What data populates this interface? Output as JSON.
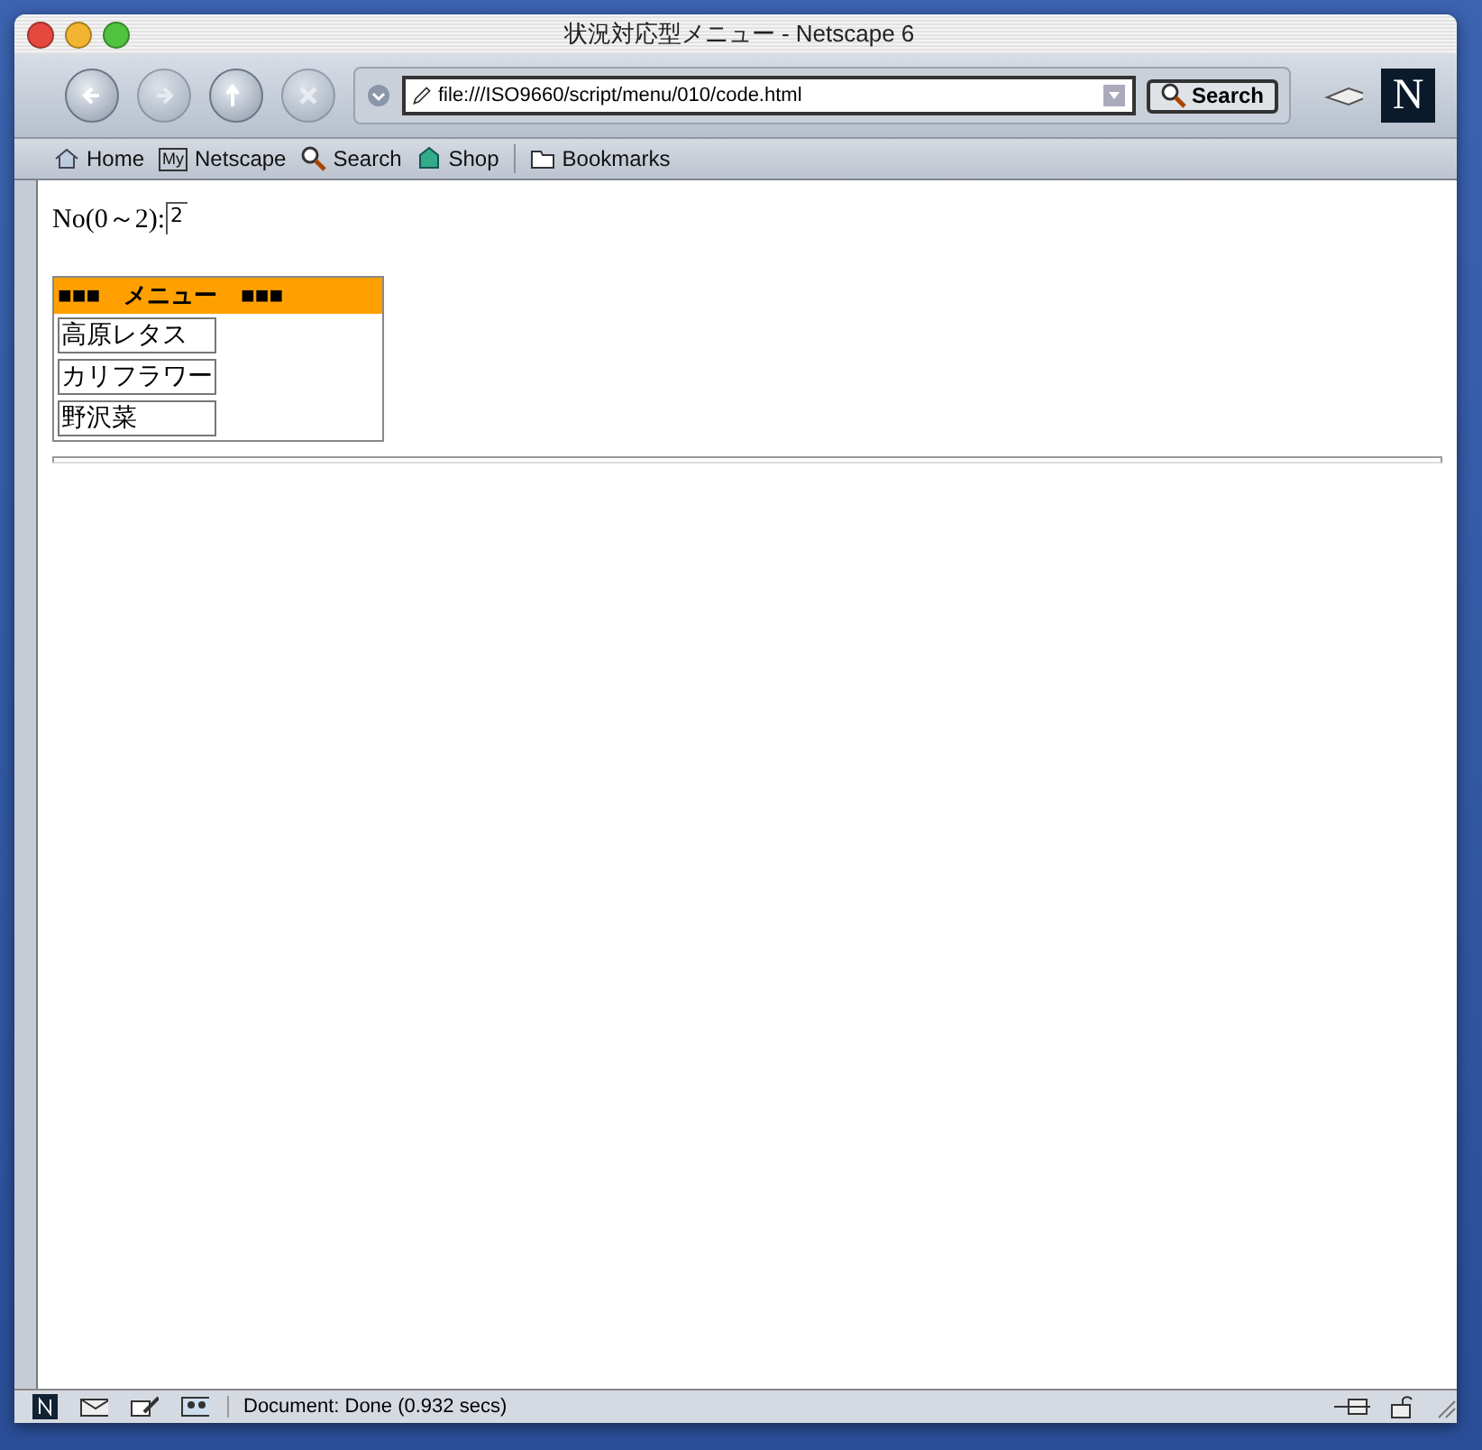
{
  "window": {
    "title": "状況対応型メニュー - Netscape 6"
  },
  "toolbar": {
    "url": "file:///ISO9660/script/menu/010/code.html",
    "search_button": "Search",
    "logo": "N"
  },
  "personal_toolbar": [
    {
      "label": "Home"
    },
    {
      "label": "Netscape",
      "badge": "My"
    },
    {
      "label": "Search"
    },
    {
      "label": "Shop"
    },
    {
      "label": "Bookmarks"
    }
  ],
  "page": {
    "number_label": "No(0～2):",
    "number_value": "2",
    "menu": {
      "title": "■■■　メニュー　■■■",
      "items": [
        "高原レタス",
        "カリフラワー",
        "野沢菜"
      ]
    }
  },
  "status_bar": {
    "text": "Document: Done (0.932 secs)"
  }
}
